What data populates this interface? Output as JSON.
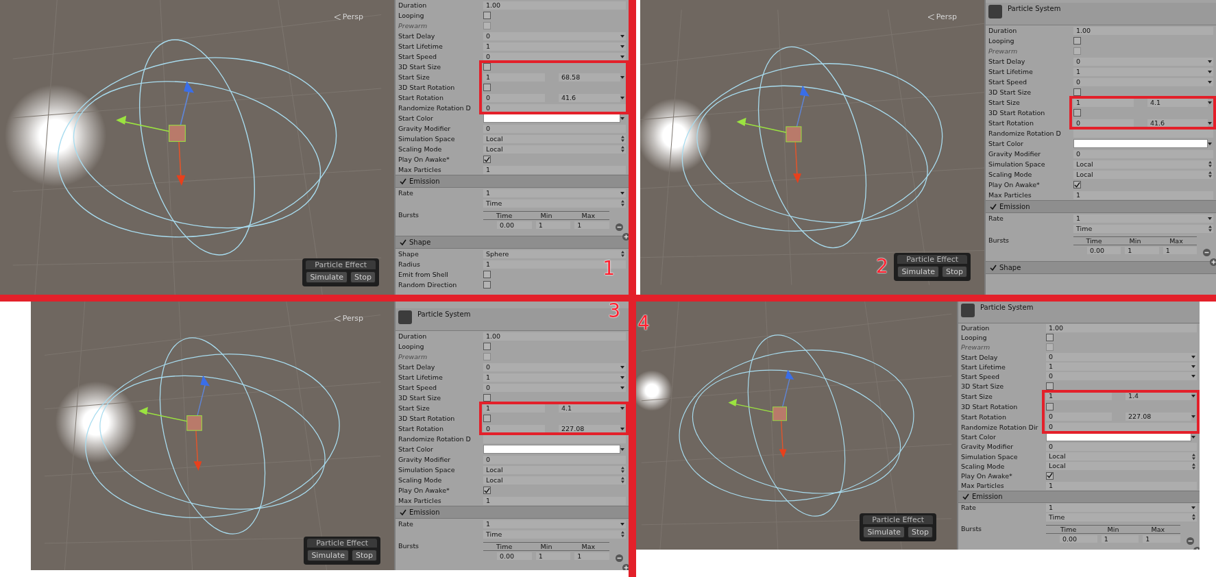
{
  "quadrants": [
    {
      "number": "1",
      "viewport": {
        "view_label": "Persp",
        "effect": {
          "title": "Particle Effect",
          "buttons": [
            "Simulate",
            "Stop"
          ]
        }
      },
      "inspector": {
        "rows": [
          {
            "kind": "value",
            "label": "Duration",
            "value": "1.00",
            "menu": false
          },
          {
            "kind": "checkbox",
            "label": "Looping",
            "checked": false,
            "disabled": false
          },
          {
            "kind": "checkbox",
            "label": "Prewarm",
            "checked": false,
            "disabled": true
          },
          {
            "kind": "value",
            "label": "Start Delay",
            "value": "0",
            "menu": true
          },
          {
            "kind": "value",
            "label": "Start Lifetime",
            "value": "1",
            "menu": true
          },
          {
            "kind": "value",
            "label": "Start Speed",
            "value": "0",
            "menu": true
          },
          {
            "kind": "highlight",
            "children": [
              {
                "kind": "checkbox",
                "label": "3D Start Size",
                "checked": false,
                "disabled": false
              },
              {
                "kind": "pair",
                "label": "Start Size",
                "min": "1",
                "max": "68.58"
              },
              {
                "kind": "checkbox",
                "label": "3D Start Rotation",
                "checked": false,
                "disabled": false
              },
              {
                "kind": "pair",
                "label": "Start Rotation",
                "min": "0",
                "max": "41.6"
              },
              {
                "kind": "value",
                "label": "Randomize Rotation D",
                "value": "0",
                "menu": false
              }
            ]
          },
          {
            "kind": "color",
            "label": "Start Color"
          },
          {
            "kind": "value",
            "label": "Gravity Modifier",
            "value": "0",
            "menu": false
          },
          {
            "kind": "select",
            "label": "Simulation Space",
            "value": "Local"
          },
          {
            "kind": "select",
            "label": "Scaling Mode",
            "value": "Local"
          },
          {
            "kind": "checkbox",
            "label": "Play On Awake*",
            "checked": true,
            "disabled": false
          },
          {
            "kind": "value",
            "label": "Max Particles",
            "value": "1",
            "menu": false
          },
          {
            "kind": "section",
            "label": "Emission",
            "checked": true
          },
          {
            "kind": "value",
            "label": "Rate",
            "value": "1",
            "menu": true
          },
          {
            "kind": "select",
            "value": "Time"
          },
          {
            "kind": "bursts",
            "label": "Bursts",
            "columns": [
              "Time",
              "Min",
              "Max"
            ],
            "values": [
              "0.00",
              "1",
              "1"
            ]
          },
          {
            "kind": "section",
            "label": "Shape",
            "checked": true
          },
          {
            "kind": "select",
            "label": "Shape",
            "value": "Sphere"
          },
          {
            "kind": "value",
            "label": "Radius",
            "value": "1",
            "menu": false
          },
          {
            "kind": "checkbox",
            "label": "Emit from Shell",
            "checked": false,
            "disabled": false
          },
          {
            "kind": "checkbox",
            "label": "Random Direction",
            "checked": false,
            "disabled": false
          }
        ]
      }
    },
    {
      "number": "2",
      "viewport": {
        "view_label": "Persp",
        "effect": {
          "title": "Particle Effect",
          "buttons": [
            "Simulate",
            "Stop"
          ]
        }
      },
      "inspector": {
        "title": "Particle System",
        "rows": [
          {
            "kind": "value",
            "label": "Duration",
            "value": "1.00",
            "menu": false
          },
          {
            "kind": "checkbox",
            "label": "Looping",
            "checked": false,
            "disabled": false
          },
          {
            "kind": "checkbox",
            "label": "Prewarm",
            "checked": false,
            "disabled": true
          },
          {
            "kind": "value",
            "label": "Start Delay",
            "value": "0",
            "menu": true
          },
          {
            "kind": "value",
            "label": "Start Lifetime",
            "value": "1",
            "menu": true
          },
          {
            "kind": "value",
            "label": "Start Speed",
            "value": "0",
            "menu": true
          },
          {
            "kind": "checkbox",
            "label": "3D Start Size",
            "checked": false,
            "disabled": false
          },
          {
            "kind": "highlight",
            "children": [
              {
                "kind": "pair",
                "label": "Start Size",
                "min": "1",
                "max": "4.1"
              },
              {
                "kind": "checkbox",
                "label": "3D Start Rotation",
                "checked": false,
                "disabled": false
              },
              {
                "kind": "pair",
                "label": "Start Rotation",
                "min": "0",
                "max": "41.6"
              }
            ]
          },
          {
            "kind": "value",
            "label": "Randomize Rotation D",
            "menu": false
          },
          {
            "kind": "color",
            "label": "Start Color"
          },
          {
            "kind": "value",
            "label": "Gravity Modifier",
            "value": "0",
            "menu": false
          },
          {
            "kind": "select",
            "label": "Simulation Space",
            "value": "Local"
          },
          {
            "kind": "select",
            "label": "Scaling Mode",
            "value": "Local"
          },
          {
            "kind": "checkbox",
            "label": "Play On Awake*",
            "checked": true,
            "disabled": false
          },
          {
            "kind": "value",
            "label": "Max Particles",
            "value": "1",
            "menu": false
          },
          {
            "kind": "section",
            "label": "Emission",
            "checked": true
          },
          {
            "kind": "value",
            "label": "Rate",
            "value": "1",
            "menu": true
          },
          {
            "kind": "select",
            "value": "Time"
          },
          {
            "kind": "bursts",
            "label": "Bursts",
            "columns": [
              "Time",
              "Min",
              "Max"
            ],
            "values": [
              "0.00",
              "1",
              "1"
            ]
          },
          {
            "kind": "section",
            "label": "Shape",
            "checked": true
          }
        ]
      }
    },
    {
      "number": "3",
      "viewport": {
        "view_label": "Persp",
        "effect": {
          "title": "Particle Effect",
          "buttons": [
            "Simulate",
            "Stop"
          ]
        }
      },
      "inspector": {
        "title": "Particle System",
        "rows": [
          {
            "kind": "value",
            "label": "Duration",
            "value": "1.00",
            "menu": false
          },
          {
            "kind": "checkbox",
            "label": "Looping",
            "checked": false,
            "disabled": false
          },
          {
            "kind": "checkbox",
            "label": "Prewarm",
            "checked": false,
            "disabled": true
          },
          {
            "kind": "value",
            "label": "Start Delay",
            "value": "0",
            "menu": true
          },
          {
            "kind": "value",
            "label": "Start Lifetime",
            "value": "1",
            "menu": true
          },
          {
            "kind": "value",
            "label": "Start Speed",
            "value": "0",
            "menu": true
          },
          {
            "kind": "checkbox",
            "label": "3D Start Size",
            "checked": false,
            "disabled": false
          },
          {
            "kind": "highlight",
            "children": [
              {
                "kind": "pair",
                "label": "Start Size",
                "min": "1",
                "max": "4.1"
              },
              {
                "kind": "checkbox",
                "label": "3D Start Rotation",
                "checked": false,
                "disabled": false
              },
              {
                "kind": "pair",
                "label": "Start Rotation",
                "min": "0",
                "max": "227.08"
              }
            ]
          },
          {
            "kind": "value",
            "label": "Randomize Rotation D",
            "menu": false
          },
          {
            "kind": "color",
            "label": "Start Color"
          },
          {
            "kind": "value",
            "label": "Gravity Modifier",
            "value": "0",
            "menu": false
          },
          {
            "kind": "select",
            "label": "Simulation Space",
            "value": "Local"
          },
          {
            "kind": "select",
            "label": "Scaling Mode",
            "value": "Local"
          },
          {
            "kind": "checkbox",
            "label": "Play On Awake*",
            "checked": true,
            "disabled": false
          },
          {
            "kind": "value",
            "label": "Max Particles",
            "value": "1",
            "menu": false
          },
          {
            "kind": "section",
            "label": "Emission",
            "checked": true
          },
          {
            "kind": "value",
            "label": "Rate",
            "value": "1",
            "menu": true
          },
          {
            "kind": "select",
            "value": "Time"
          },
          {
            "kind": "bursts",
            "label": "Bursts",
            "columns": [
              "Time",
              "Min",
              "Max"
            ],
            "values": [
              "0.00",
              "1",
              "1"
            ]
          }
        ]
      }
    },
    {
      "number": "4",
      "viewport": {
        "effect": {
          "title": "Particle Effect",
          "buttons": [
            "Simulate",
            "Stop"
          ]
        }
      },
      "inspector": {
        "title": "Particle System",
        "rows": [
          {
            "kind": "value",
            "label": "Duration",
            "value": "1.00",
            "menu": false
          },
          {
            "kind": "checkbox",
            "label": "Looping",
            "checked": false,
            "disabled": false
          },
          {
            "kind": "checkbox",
            "label": "Prewarm",
            "checked": false,
            "disabled": true
          },
          {
            "kind": "value",
            "label": "Start Delay",
            "value": "0",
            "menu": true
          },
          {
            "kind": "value",
            "label": "Start Lifetime",
            "value": "1",
            "menu": true
          },
          {
            "kind": "value",
            "label": "Start Speed",
            "value": "0",
            "menu": true
          },
          {
            "kind": "checkbox",
            "label": "3D Start Size",
            "checked": false,
            "disabled": false
          },
          {
            "kind": "highlight",
            "children": [
              {
                "kind": "pair",
                "label": "Start Size",
                "min": "1",
                "max": "1.4"
              },
              {
                "kind": "checkbox",
                "label": "3D Start Rotation",
                "checked": false,
                "disabled": false
              },
              {
                "kind": "pair",
                "label": "Start Rotation",
                "min": "0",
                "max": "227.08"
              },
              {
                "kind": "value",
                "label": "Randomize Rotation Dir",
                "value": "0",
                "menu": false
              }
            ]
          },
          {
            "kind": "color",
            "label": "Start Color"
          },
          {
            "kind": "value",
            "label": "Gravity Modifier",
            "value": "0",
            "menu": false
          },
          {
            "kind": "select",
            "label": "Simulation Space",
            "value": "Local"
          },
          {
            "kind": "select",
            "label": "Scaling Mode",
            "value": "Local"
          },
          {
            "kind": "checkbox",
            "label": "Play On Awake*",
            "checked": true,
            "disabled": false
          },
          {
            "kind": "value",
            "label": "Max Particles",
            "value": "1",
            "menu": false
          },
          {
            "kind": "section",
            "label": "Emission",
            "checked": true
          },
          {
            "kind": "value",
            "label": "Rate",
            "value": "1",
            "menu": true
          },
          {
            "kind": "select",
            "value": "Time"
          },
          {
            "kind": "bursts",
            "label": "Bursts",
            "columns": [
              "Time",
              "Min",
              "Max"
            ],
            "values": [
              "0.00",
              "1",
              "1"
            ]
          }
        ]
      }
    }
  ]
}
